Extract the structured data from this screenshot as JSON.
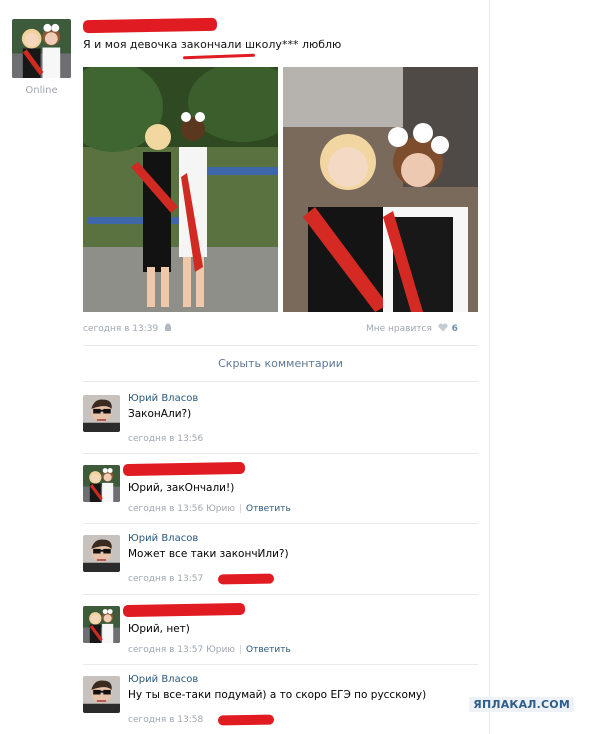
{
  "post": {
    "status": "Online",
    "text": "Я и моя девочка закончали школу*** люблю",
    "time": "сегодня в 13:39",
    "likes_label": "Мне нравится",
    "likes_count": "6"
  },
  "comments_toggle": "Скрыть комментарии",
  "comments": [
    {
      "name": "Юрий Власов",
      "text": "ЗаконАли?)",
      "time": "сегодня в 13:56",
      "to": "",
      "reply": ""
    },
    {
      "name": "",
      "text": "Юрий, закОнчали!)",
      "time": "сегодня в 13:56",
      "to": "Юрию",
      "reply": "Ответить"
    },
    {
      "name": "Юрий Власов",
      "text": "Может все таки закончИли?)",
      "time": "сегодня в 13:57",
      "to": "",
      "reply": ""
    },
    {
      "name": "",
      "text": "Юрий, нет)",
      "time": "сегодня в 13:57",
      "to": "Юрию",
      "reply": "Ответить"
    },
    {
      "name": "Юрий Власов",
      "text": "Ну ты все-таки подумай) а то скоро ЕГЭ по русскому)",
      "time": "сегодня в 13:58",
      "to": "",
      "reply": ""
    }
  ],
  "watermark": "ЯПЛАКАЛ.COM",
  "icons": {
    "mobile": "android-icon",
    "heart": "heart-icon"
  },
  "colors": {
    "link": "#2b587a",
    "redaction": "#e01b22",
    "meta": "#a0a7b0"
  }
}
